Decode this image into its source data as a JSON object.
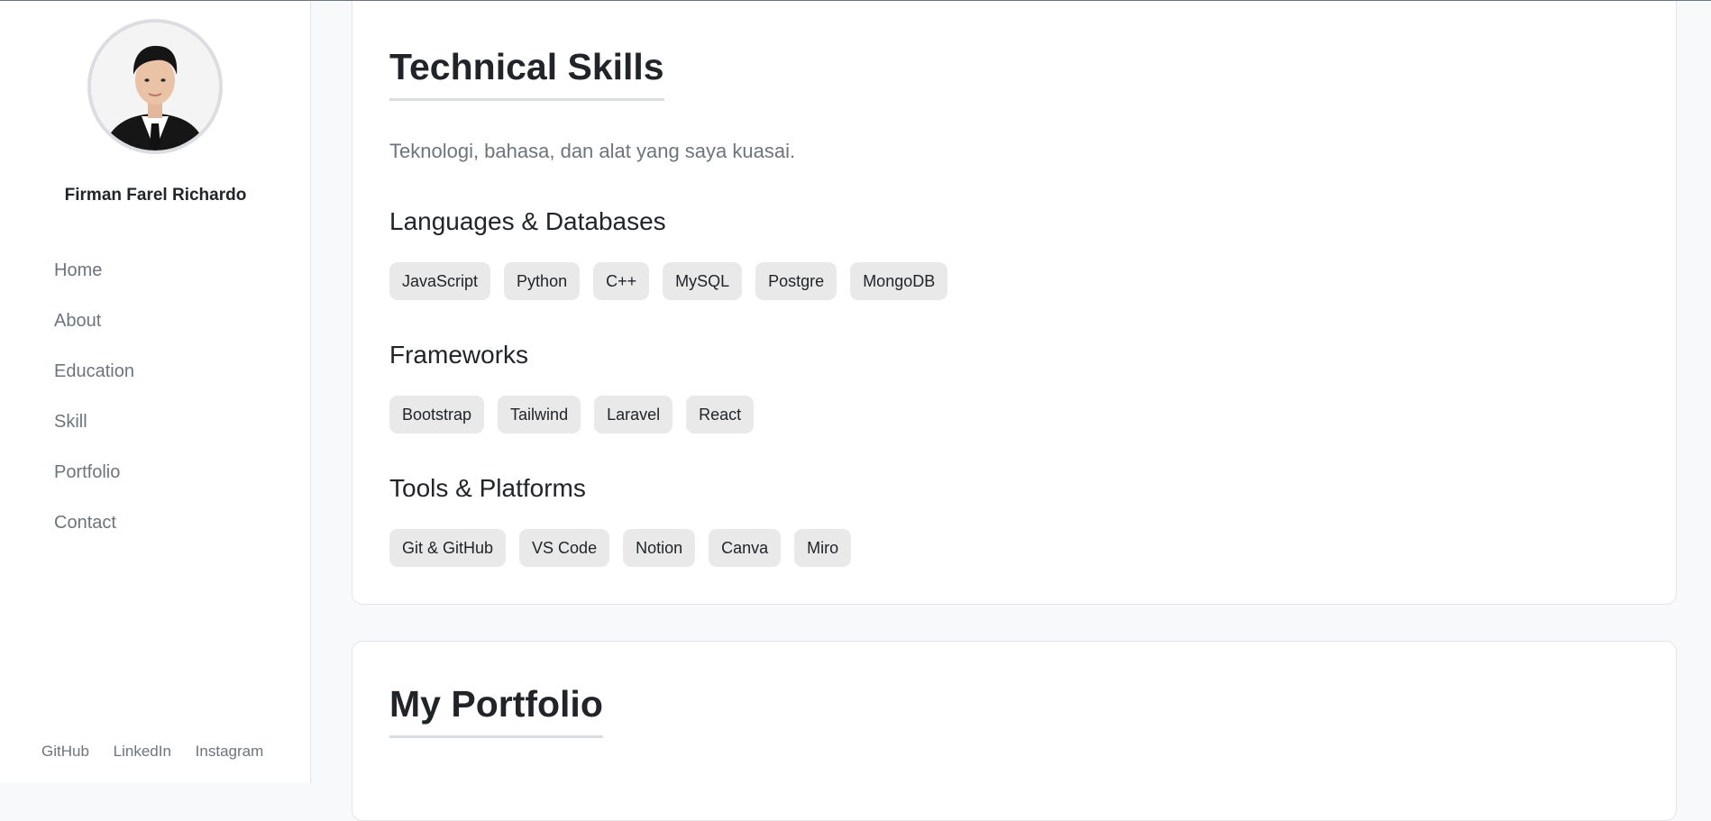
{
  "sidebar": {
    "profile_name": "Firman Farel Richardo",
    "nav": [
      {
        "label": "Home"
      },
      {
        "label": "About"
      },
      {
        "label": "Education"
      },
      {
        "label": "Skill"
      },
      {
        "label": "Portfolio"
      },
      {
        "label": "Contact"
      }
    ],
    "social": [
      {
        "label": "GitHub"
      },
      {
        "label": "LinkedIn"
      },
      {
        "label": "Instagram"
      }
    ]
  },
  "skills": {
    "title": "Technical Skills",
    "subtitle": "Teknologi, bahasa, dan alat yang saya kuasai.",
    "groups": [
      {
        "title": "Languages & Databases",
        "items": [
          "JavaScript",
          "Python",
          "C++",
          "MySQL",
          "Postgre",
          "MongoDB"
        ]
      },
      {
        "title": "Frameworks",
        "items": [
          "Bootstrap",
          "Tailwind",
          "Laravel",
          "React"
        ]
      },
      {
        "title": "Tools & Platforms",
        "items": [
          "Git & GitHub",
          "VS Code",
          "Notion",
          "Canva",
          "Miro"
        ]
      }
    ]
  },
  "portfolio": {
    "title": "My Portfolio"
  }
}
